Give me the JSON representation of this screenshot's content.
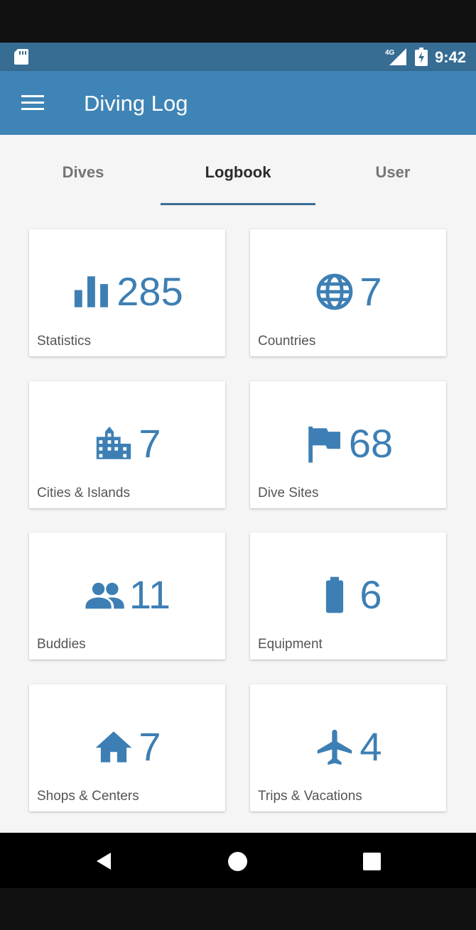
{
  "status_bar": {
    "time": "9:42",
    "network": "4G"
  },
  "app_bar": {
    "title": "Diving Log"
  },
  "tabs": [
    {
      "label": "Dives",
      "active": false
    },
    {
      "label": "Logbook",
      "active": true
    },
    {
      "label": "User",
      "active": false
    }
  ],
  "cards": [
    {
      "label": "Statistics",
      "value": "285",
      "icon": "bar-chart-icon"
    },
    {
      "label": "Countries",
      "value": "7",
      "icon": "globe-icon"
    },
    {
      "label": "Cities & Islands",
      "value": "7",
      "icon": "city-icon"
    },
    {
      "label": "Dive Sites",
      "value": "68",
      "icon": "flag-icon"
    },
    {
      "label": "Buddies",
      "value": "11",
      "icon": "people-icon"
    },
    {
      "label": "Equipment",
      "value": "6",
      "icon": "battery-icon"
    },
    {
      "label": "Shops & Centers",
      "value": "7",
      "icon": "home-icon"
    },
    {
      "label": "Trips & Vacations",
      "value": "4",
      "icon": "airplane-icon"
    }
  ],
  "colors": {
    "accent": "#3d7fb4",
    "app_bar": "#3f84b6",
    "status_bar": "#376c93"
  }
}
